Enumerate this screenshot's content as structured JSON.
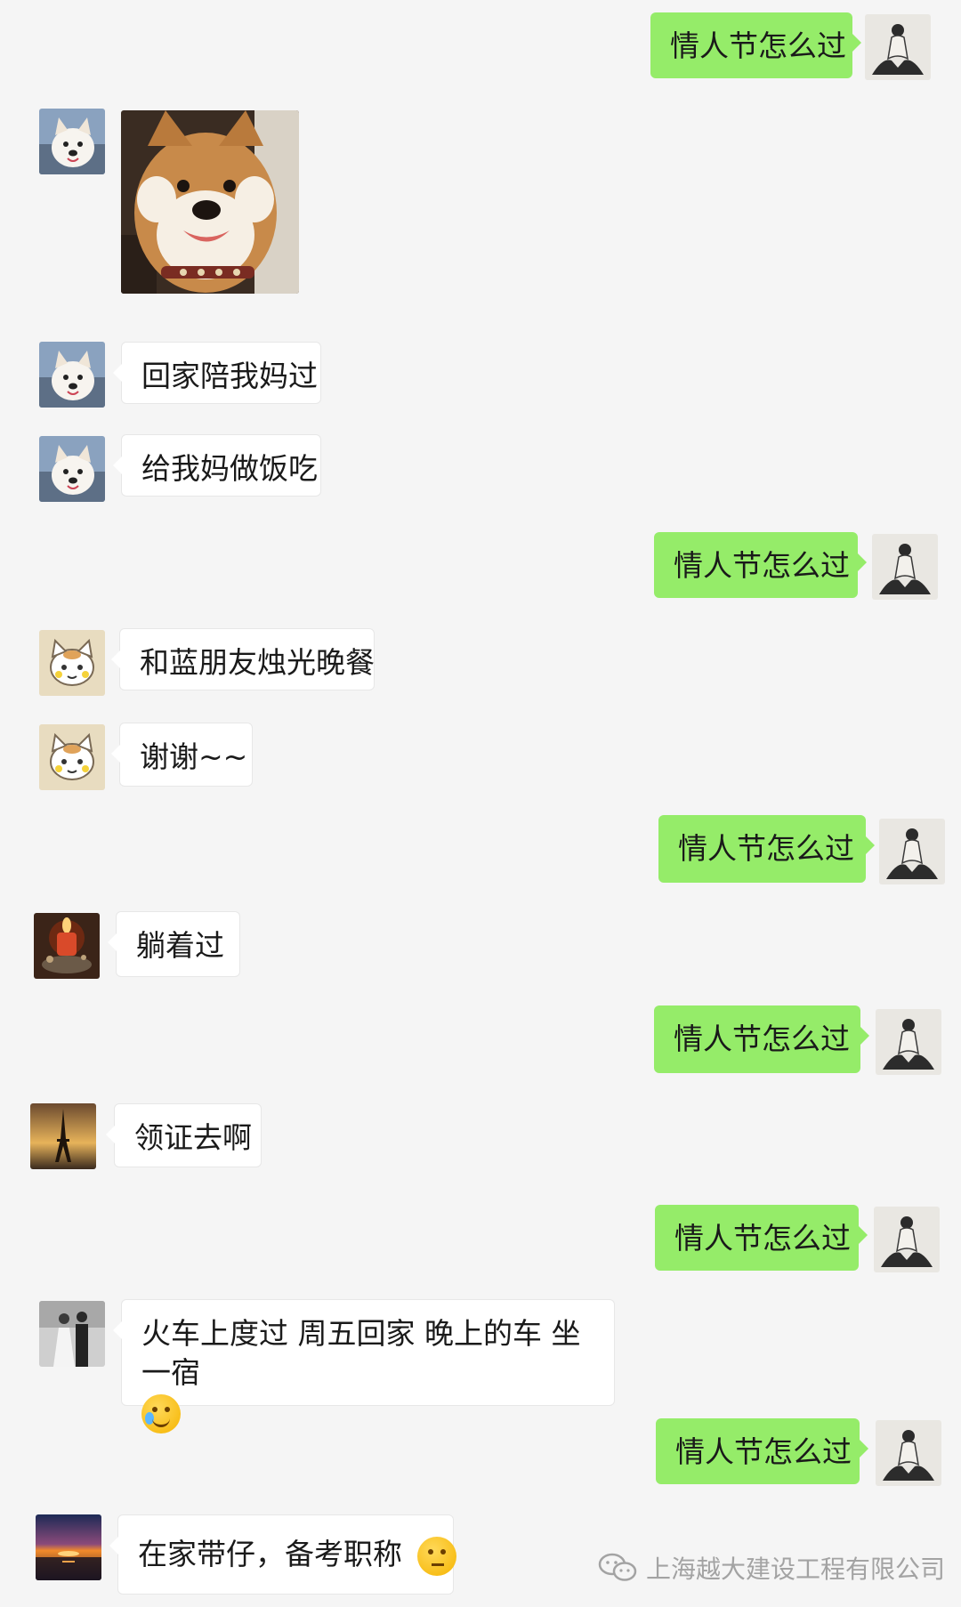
{
  "conversation": {
    "messages": [
      {
        "side": "out",
        "type": "text",
        "text": "情人节怎么过"
      },
      {
        "side": "in",
        "type": "image",
        "image_label": "shiba-dog-sticker"
      },
      {
        "side": "in",
        "type": "text",
        "text": "回家陪我妈过"
      },
      {
        "side": "in",
        "type": "text",
        "text": "给我妈做饭吃"
      },
      {
        "side": "out",
        "type": "text",
        "text": "情人节怎么过"
      },
      {
        "side": "in",
        "type": "text",
        "text": "和蓝朋友烛光晚餐"
      },
      {
        "side": "in",
        "type": "text",
        "text": "谢谢~~"
      },
      {
        "side": "out",
        "type": "text",
        "text": "情人节怎么过"
      },
      {
        "side": "in",
        "type": "text",
        "text": "躺着过"
      },
      {
        "side": "out",
        "type": "text",
        "text": "情人节怎么过"
      },
      {
        "side": "in",
        "type": "text",
        "text": "领证去啊"
      },
      {
        "side": "out",
        "type": "text",
        "text": "情人节怎么过"
      },
      {
        "side": "in",
        "type": "text",
        "text": "火车上度过 周五回家 晚上的车 坐一宿",
        "emoji": "crying-laughing-emoji"
      },
      {
        "side": "out",
        "type": "text",
        "text": "情人节怎么过"
      },
      {
        "side": "in",
        "type": "text",
        "text": "在家带仔，备考职称",
        "emoji": "thinking-emoji"
      }
    ]
  },
  "watermark": {
    "text": "上海越大建设工程有限公司",
    "icon": "wechat-icon"
  },
  "colors": {
    "background": "#f5f5f5",
    "outgoing_bubble": "#95ec69",
    "incoming_bubble": "#ffffff",
    "watermark": "#a3a3a3"
  }
}
